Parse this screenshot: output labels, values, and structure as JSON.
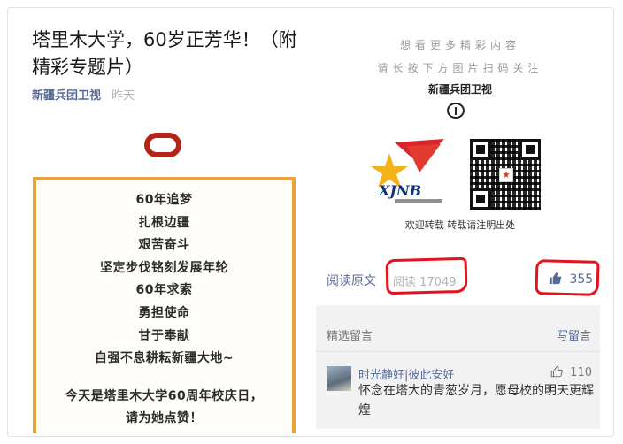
{
  "article": {
    "title": "塔里木大学，60岁正芳华！（附精彩专题片）",
    "account": "新疆兵团卫视",
    "time": "昨天"
  },
  "poster": {
    "lines": [
      "60年追梦",
      "扎根边疆",
      "艰苦奋斗",
      "坚定步伐铭刻发展年轮",
      "60年求索",
      "勇担使命",
      "甘于奉献",
      "自强不息耕耘新疆大地~"
    ],
    "closing": [
      "今天是塔里木大学60周年校庆日，",
      "请为她点赞！"
    ],
    "ring_color": "#b52418",
    "border_color": "#e8a33b"
  },
  "promo": {
    "invite": [
      "想看更多精彩内容",
      "请长按下方图片扫码关注"
    ],
    "brand": "新疆兵团卫视",
    "logo_text": "XJNB",
    "repost": "欢迎转载  转载请注明出处"
  },
  "stats": {
    "read_original": "阅读原文",
    "read_count": "阅读 17049",
    "likes": "355"
  },
  "comments": {
    "header": "精选留言",
    "write": "写留言",
    "items": [
      {
        "user": "时光静好|彼此安好",
        "likes": "110",
        "text": "怀念在塔大的青葱岁月，愿母校的明天更辉煌"
      }
    ]
  },
  "colors": {
    "link": "#576b95",
    "annotation_red": "#e4121e"
  }
}
